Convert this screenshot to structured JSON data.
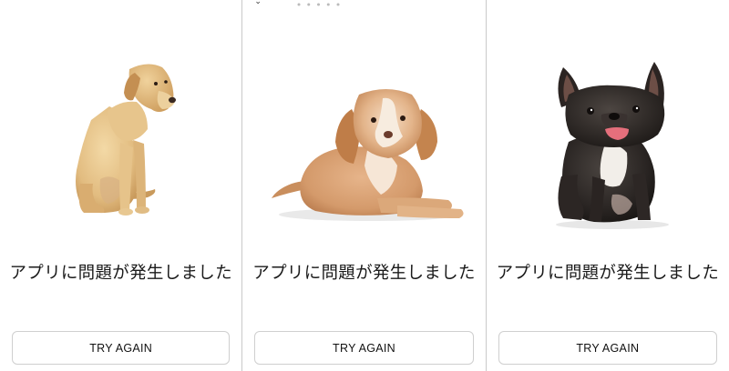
{
  "panels": [
    {
      "dog": "labrador-retriever",
      "message": "アプリに問題が発生しました",
      "button": "TRY AGAIN"
    },
    {
      "dog": "cavapoo",
      "message": "アプリに問題が発生しました",
      "button": "TRY AGAIN",
      "status_icon": "chevron-down-icon"
    },
    {
      "dog": "french-bulldog",
      "message": "アプリに問題が発生しました",
      "button": "TRY AGAIN"
    }
  ],
  "colors": {
    "background": "#ffffff",
    "divider": "#c9c9c9",
    "button_border": "#cfcfcf",
    "text": "#1a1a1a"
  }
}
